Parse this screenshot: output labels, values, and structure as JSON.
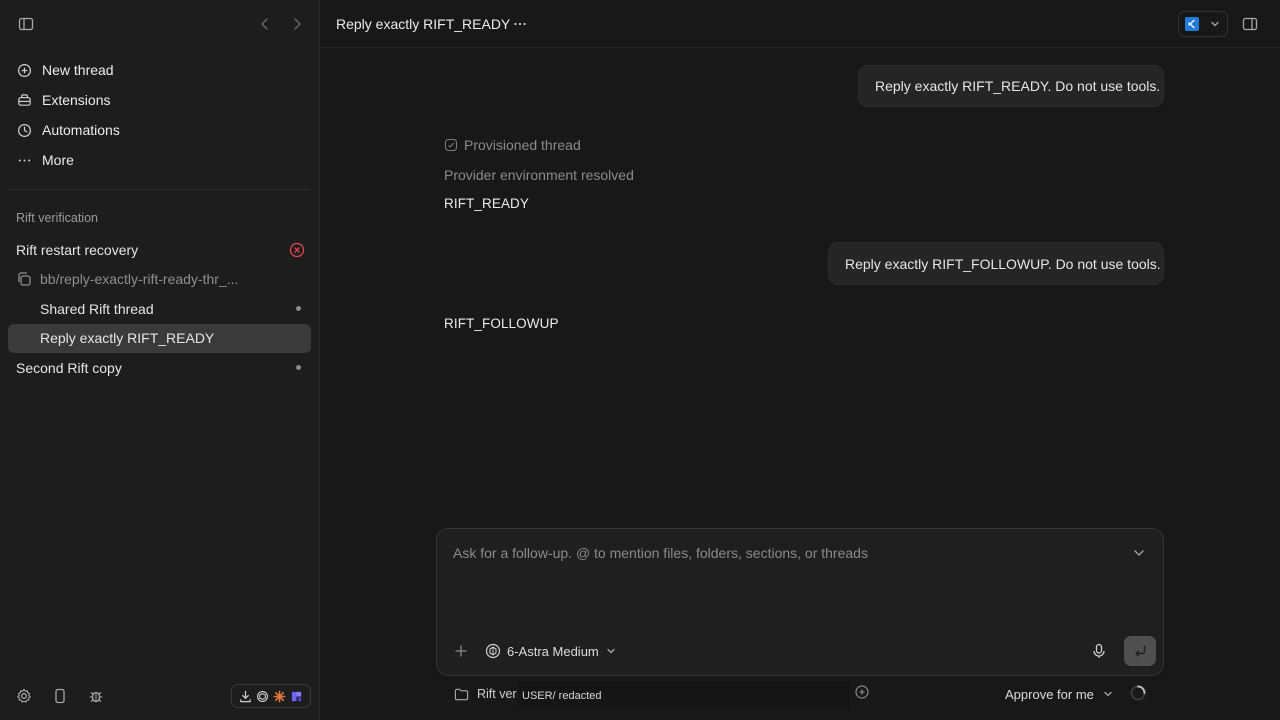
{
  "sidebar": {
    "nav": [
      {
        "label": "New thread",
        "icon": "plus-circle-icon"
      },
      {
        "label": "Extensions",
        "icon": "extensions-icon"
      },
      {
        "label": "Automations",
        "icon": "clock-icon"
      },
      {
        "label": "More",
        "icon": "more-horizontal-icon"
      }
    ],
    "section_title": "Rift verification",
    "threads": [
      {
        "label": "Rift restart recovery",
        "status": "error"
      },
      {
        "label": "bb/reply-exactly-rift-ready-thr_...",
        "status": "branch"
      },
      {
        "label": "Shared Rift thread",
        "status": "dot"
      },
      {
        "label": "Reply exactly RIFT_READY",
        "status": "active"
      },
      {
        "label": "Second Rift copy",
        "status": "dot"
      }
    ]
  },
  "header": {
    "title": "Reply exactly RIFT_READY"
  },
  "conversation": {
    "msg1": "Reply exactly RIFT_READY. Do not use tools.",
    "meta1": "Provisioned thread",
    "meta2": "Provider environment resolved",
    "reply1": "RIFT_READY",
    "msg2": "Reply exactly RIFT_FOLLOWUP. Do not use tools.",
    "reply2": "RIFT_FOLLOWUP"
  },
  "composer": {
    "placeholder": "Ask for a follow-up. @ to mention files, folders, sections, or threads",
    "model": "6-Astra Medium"
  },
  "footer": {
    "workspace": "Rift ver",
    "user_redacted": "USER/ redacted",
    "approval": "Approve for me"
  },
  "colors": {
    "background": "#181818",
    "sidebar": "#1d1d1d",
    "error": "#e5484d",
    "active_row": "#3a3a3a"
  }
}
